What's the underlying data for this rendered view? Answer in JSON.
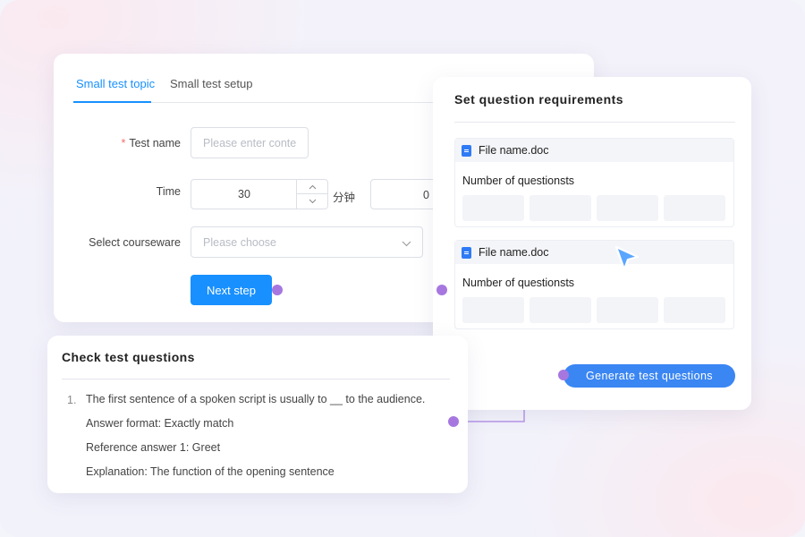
{
  "form": {
    "tabs": [
      {
        "label": "Small test topic",
        "active": true
      },
      {
        "label": "Small test setup",
        "active": false
      }
    ],
    "test_name": {
      "label": "Test name",
      "required_mark": "*",
      "placeholder": "Please enter conte"
    },
    "time": {
      "label": "Time",
      "value": "30",
      "unit": "分钟",
      "second_value": "0"
    },
    "courseware": {
      "label": "Select courseware",
      "placeholder": "Please choose"
    },
    "next_button": "Next step"
  },
  "requirements": {
    "title": "Set question requirements",
    "files": [
      {
        "name": "File name.doc",
        "field_label": "Number of questionsts"
      },
      {
        "name": "File name.doc",
        "field_label": "Number of questionsts"
      }
    ],
    "generate_button": "Generate test questions"
  },
  "check": {
    "title": "Check test questions",
    "items": [
      {
        "number": "1.",
        "question": "The first sentence of a spoken script is usually to __ to the audience.",
        "answer_format": "Answer format: Exactly match",
        "reference_answer": "Reference answer 1: Greet",
        "explanation": "Explanation: The function of the opening sentence"
      }
    ]
  },
  "colors": {
    "accent": "#1890ff",
    "generate_button": "#3a86f3",
    "connector": "#a777e0",
    "required": "#f56c6c"
  },
  "icons": {
    "file": "doc-file-icon",
    "stepper_up": "chevron-up-icon",
    "stepper_down": "chevron-down-icon",
    "select": "chevron-down-icon",
    "cursor": "pointer-cursor-icon"
  }
}
